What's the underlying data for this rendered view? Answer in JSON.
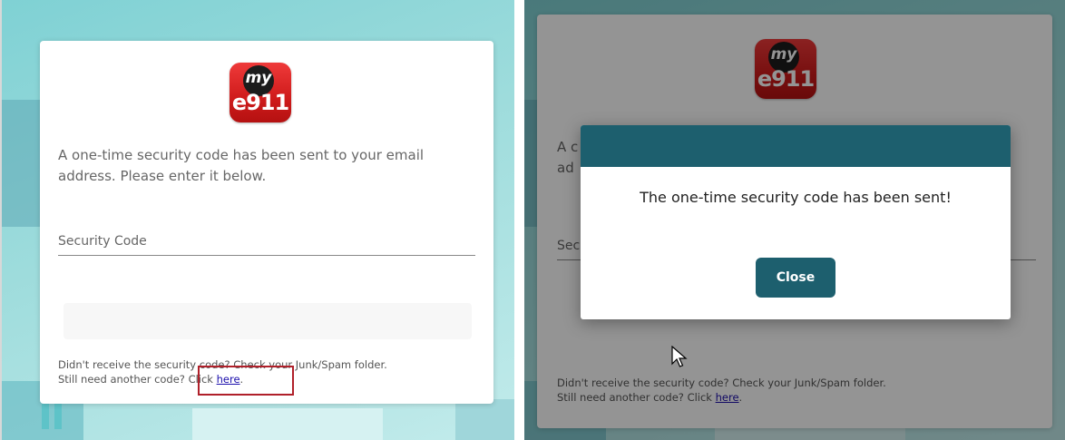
{
  "brand": {
    "logo_my": "my",
    "logo_e911": "e911",
    "accent_red": "#d42020",
    "dialog_teal": "#1d5f6e"
  },
  "left_panel": {
    "instructions": "A one-time security code has been sent to your email address. Please enter it below.",
    "security_code_placeholder": "Security Code",
    "footer_line1": "Didn't receive the security code? Check your Junk/Spam folder.",
    "footer_line2_prefix": "Still need another code? Click ",
    "footer_link": "here",
    "footer_line2_suffix": "."
  },
  "right_panel": {
    "instructions_partial": "A c\nad",
    "security_code_partial": "Sec",
    "footer_line1": "Didn't receive the security code? Check your Junk/Spam folder.",
    "footer_line2_prefix": "Still need another code? Click ",
    "footer_link": "here",
    "footer_line2_suffix": "."
  },
  "dialog": {
    "message": "The one-time security code has been sent!",
    "close_label": "Close"
  }
}
